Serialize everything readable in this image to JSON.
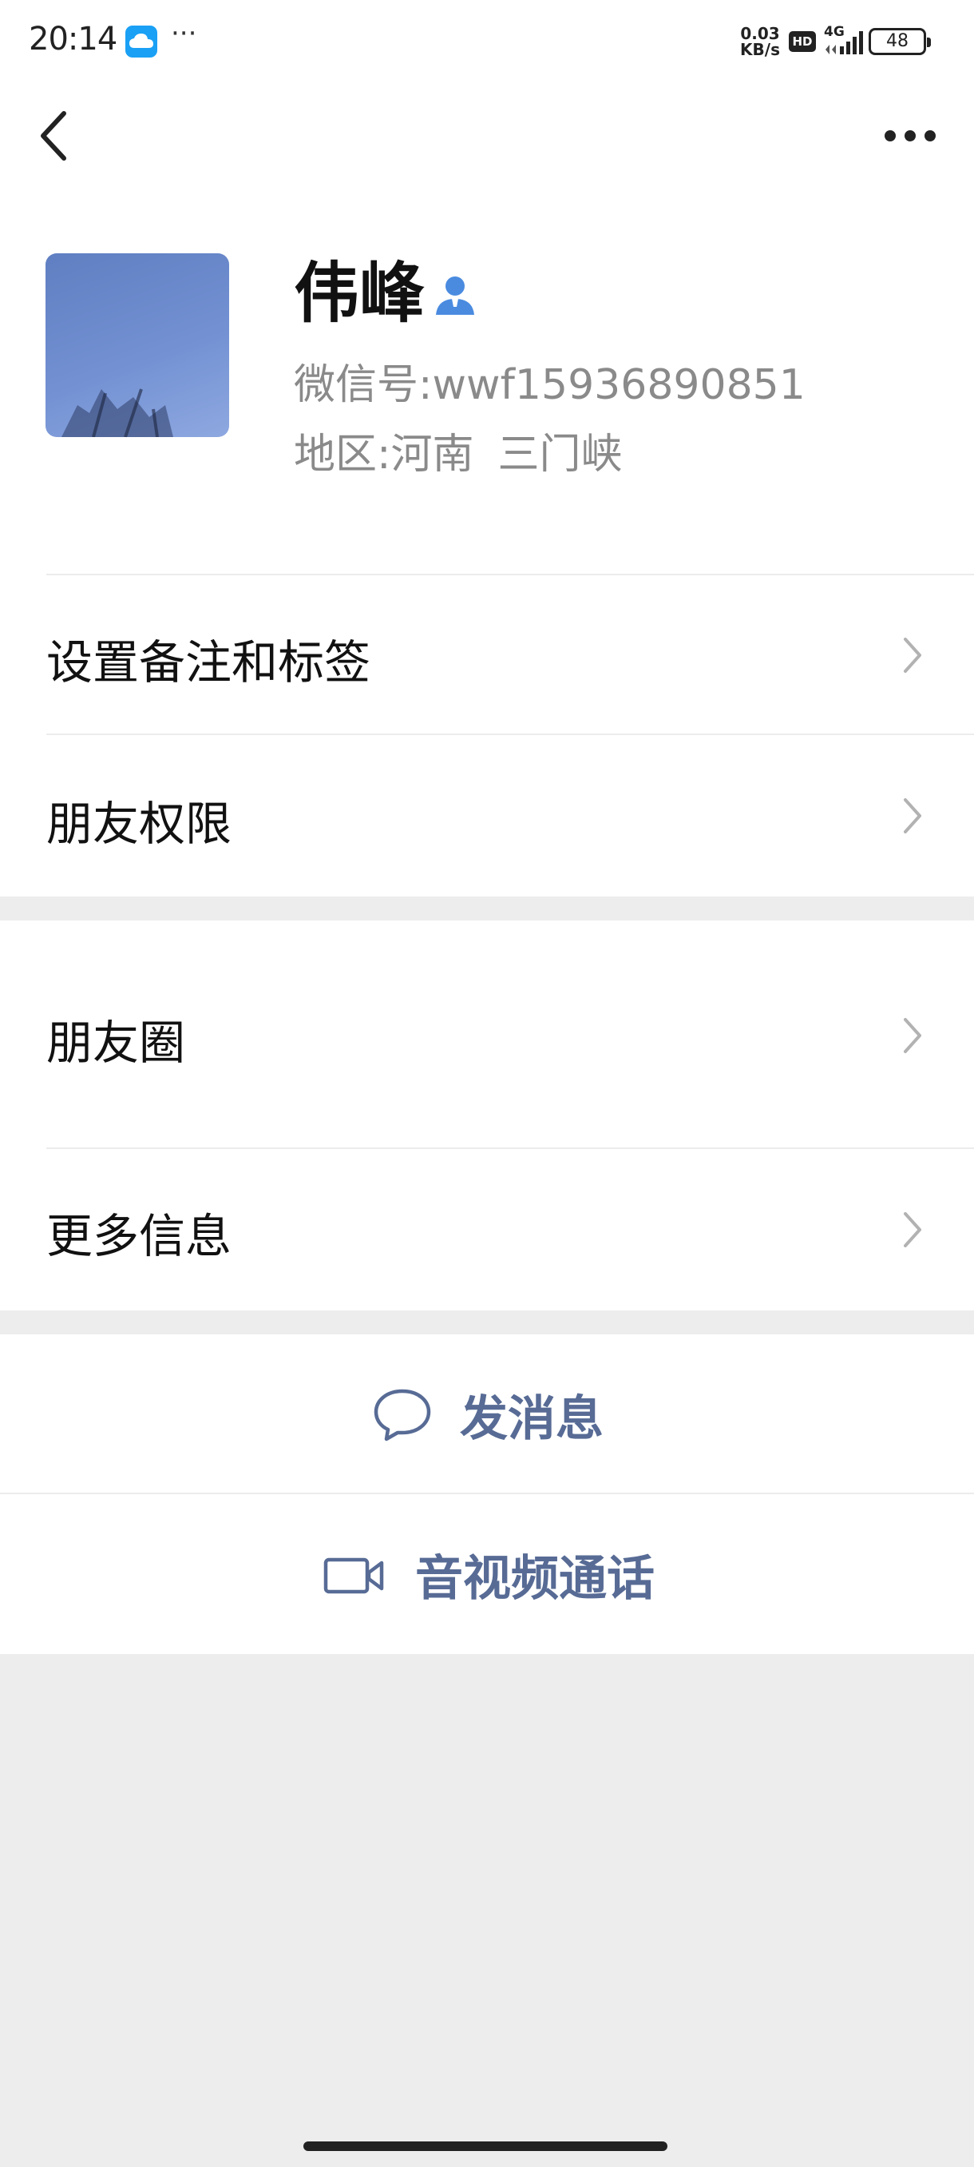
{
  "status_bar": {
    "time": "20:14",
    "net_speed_value": "0.03",
    "net_speed_unit": "KB/s",
    "hd_badge": "HD",
    "network_type": "4G",
    "battery_level": "48",
    "app_icon": "cloud-app-icon",
    "overflow_dots": "···"
  },
  "nav": {
    "back_icon": "chevron-left-icon",
    "more_icon": "more-dots-icon"
  },
  "profile": {
    "name": "伟峰",
    "contact_badge_icon": "contact-person-icon",
    "wechat_id_label": "微信号:",
    "wechat_id_value": "wwf15936890851",
    "region_label": "地区:",
    "region_province": "河南",
    "region_city": "三门峡"
  },
  "menu": {
    "remark_tags": "设置备注和标签",
    "friend_permissions": "朋友权限",
    "moments": "朋友圈",
    "more_info": "更多信息"
  },
  "actions": {
    "send_message": "发消息",
    "av_call": "音视频通话"
  },
  "colors": {
    "accent": "#576b95",
    "background": "#ededed",
    "contact_icon": "#4a8be0"
  }
}
